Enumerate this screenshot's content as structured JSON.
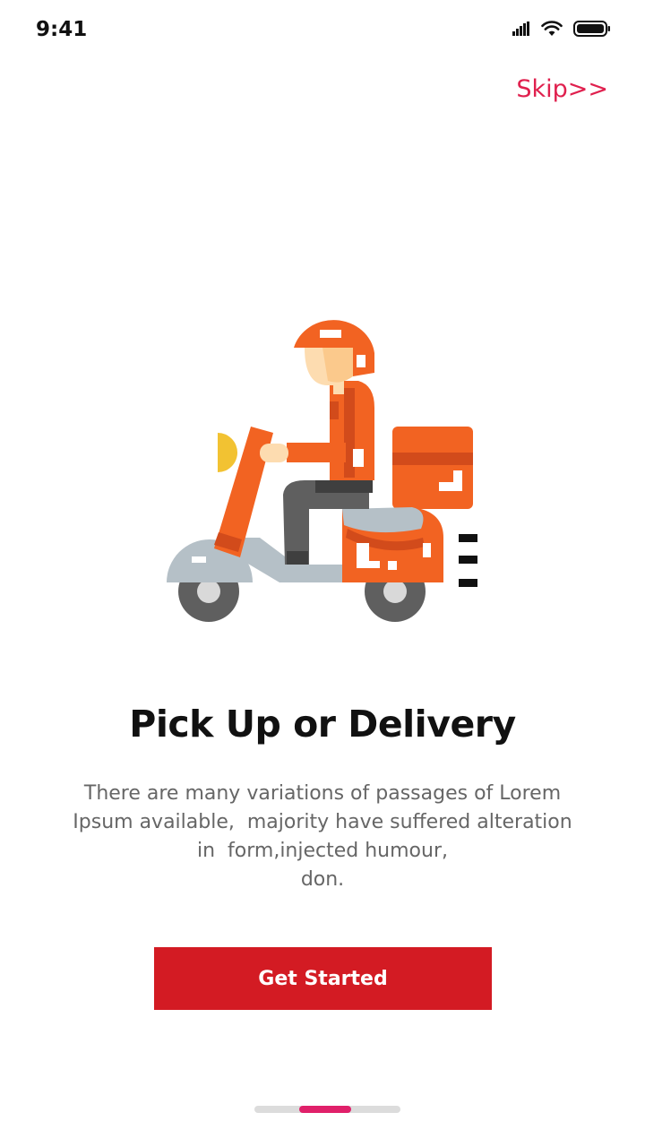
{
  "status_bar": {
    "time": "9:41"
  },
  "header": {
    "skip_label": "Skip>>"
  },
  "illustration": {
    "icon": "scooter-delivery-icon"
  },
  "main": {
    "title": "Pick Up or Delivery",
    "description_lines": [
      "There are many variations of passages of Lorem",
      "Ipsum available,  majority have suffered alteration",
      "in  form,injected humour,",
      "don."
    ]
  },
  "cta": {
    "label": "Get Started"
  },
  "pager": {
    "total": 3,
    "active_index": 1
  },
  "colors": {
    "accent": "#e0204e",
    "button": "#d31b23",
    "title": "#111111",
    "body_text": "#666666",
    "pager_active": "#e0206a",
    "pager_track": "#dcdcdc"
  }
}
